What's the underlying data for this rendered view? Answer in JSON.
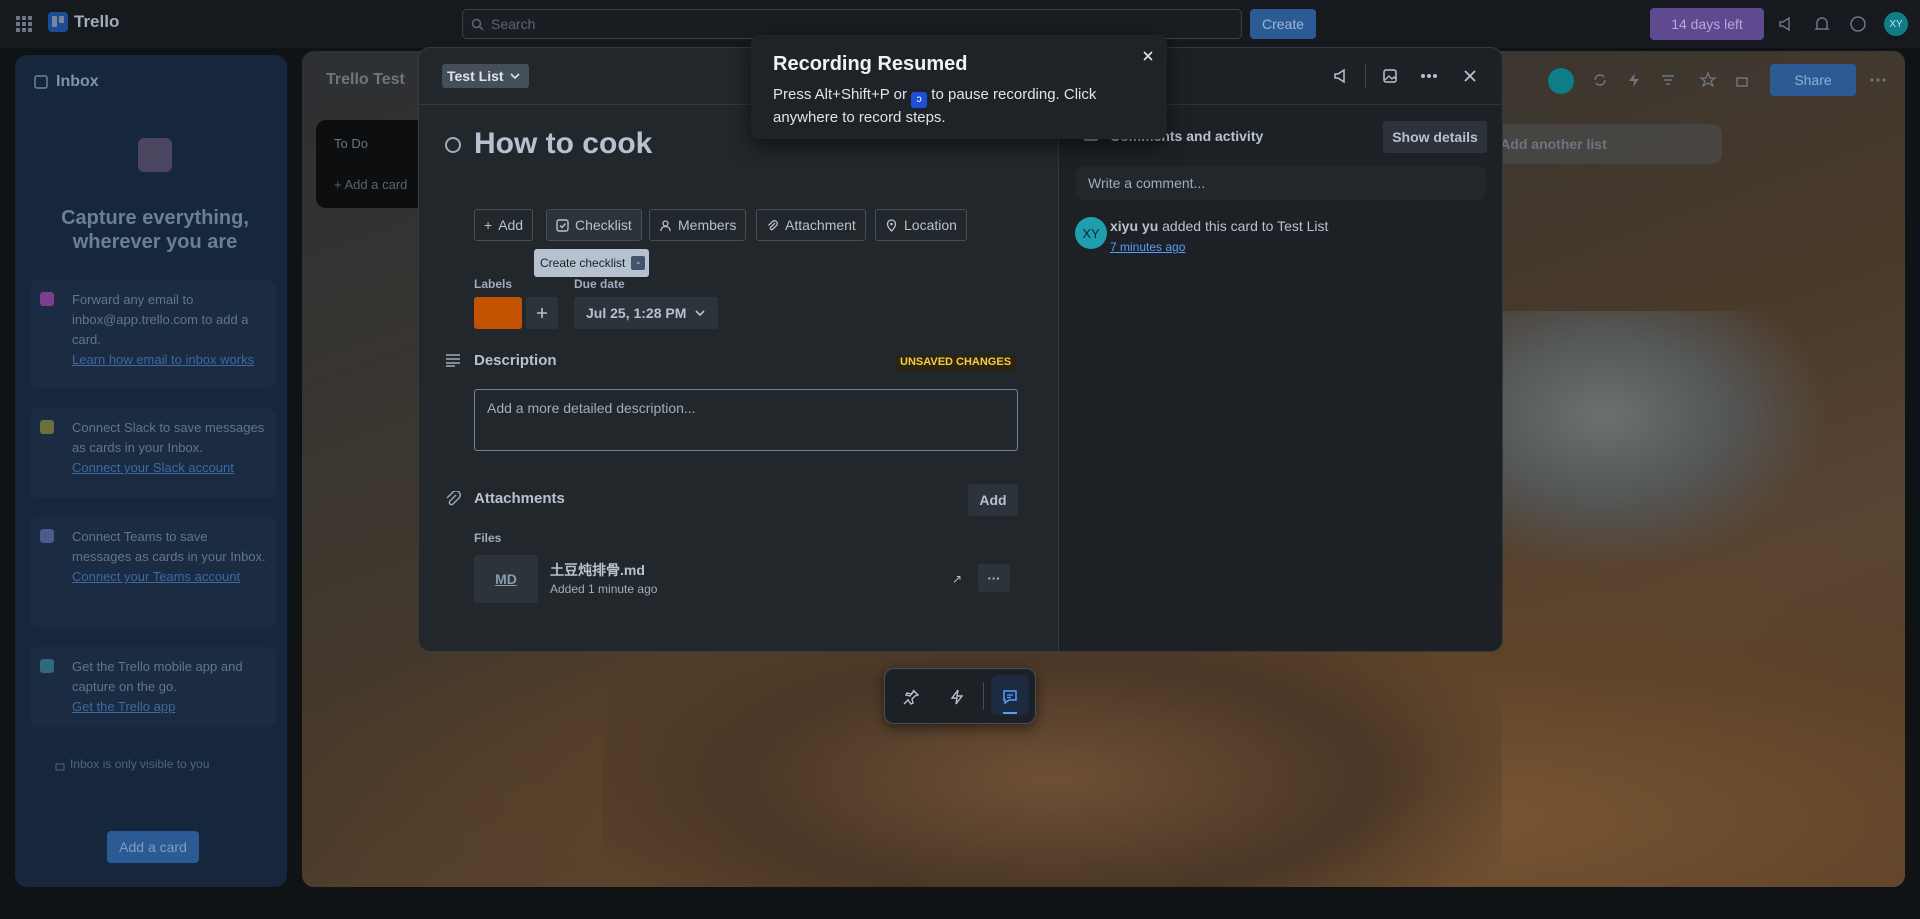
{
  "app": {
    "name": "Trello",
    "search_placeholder": "Search",
    "create_label": "Create",
    "trial_label": "14 days left",
    "user_initials": "XY"
  },
  "inbox": {
    "title": "Inbox",
    "headline": "Capture everything, wherever you are",
    "tips": [
      {
        "text": "Forward any email to inbox@app.trello.com to add a card.",
        "link": "Learn how email to inbox works"
      },
      {
        "text": "Connect Slack to save messages as cards in your Inbox.",
        "link": "Connect your Slack account"
      },
      {
        "text": "Connect Teams to save messages as cards in your Inbox.",
        "link": "Connect your Teams account"
      },
      {
        "text": "Get the Trello mobile app and capture on the go.",
        "link": "Get the Trello app"
      }
    ],
    "visibility_note": "Inbox is only visible to you",
    "add_card_label": "Add a card"
  },
  "board": {
    "title": "Trello Test",
    "list_name": "To Do",
    "add_card_label": "Add a card",
    "add_list_label": "Add another list",
    "share_label": "Share"
  },
  "card": {
    "list_name": "Test List",
    "title": "How to cook",
    "actions": [
      "Add",
      "Checklist",
      "Members",
      "Attachment",
      "Location"
    ],
    "tooltip": {
      "text": "Create checklist",
      "shortcut": "-"
    },
    "labels_heading": "Labels",
    "label_color": "#c25100",
    "due_heading": "Due date",
    "due_value": "Jul 25, 1:28 PM",
    "description_heading": "Description",
    "unsaved_badge": "UNSAVED CHANGES",
    "description_placeholder": "Add a more detailed description...",
    "attachments_heading": "Attachments",
    "attachments_add_label": "Add",
    "files_heading": "Files",
    "file": {
      "type": "MD",
      "name": "土豆炖排骨.md",
      "meta": "Added 1 minute ago",
      "open_glyph": "↗",
      "more_glyph": "···"
    }
  },
  "activity": {
    "heading": "Comments and activity",
    "show_details_label": "Show details",
    "comment_placeholder": "Write a comment...",
    "entries": [
      {
        "initials": "XY",
        "user": "xiyu yu",
        "action": " added this card to Test List",
        "time": "7 minutes ago"
      }
    ]
  },
  "recording": {
    "title": "Recording Resumed",
    "body_pre": "Press Alt+Shift+P or ",
    "body_post": " to pause recording. Click anywhere to record steps."
  },
  "colors": {
    "accent": "#579dff",
    "label": "#c25100",
    "warning": "#f5cd47"
  }
}
